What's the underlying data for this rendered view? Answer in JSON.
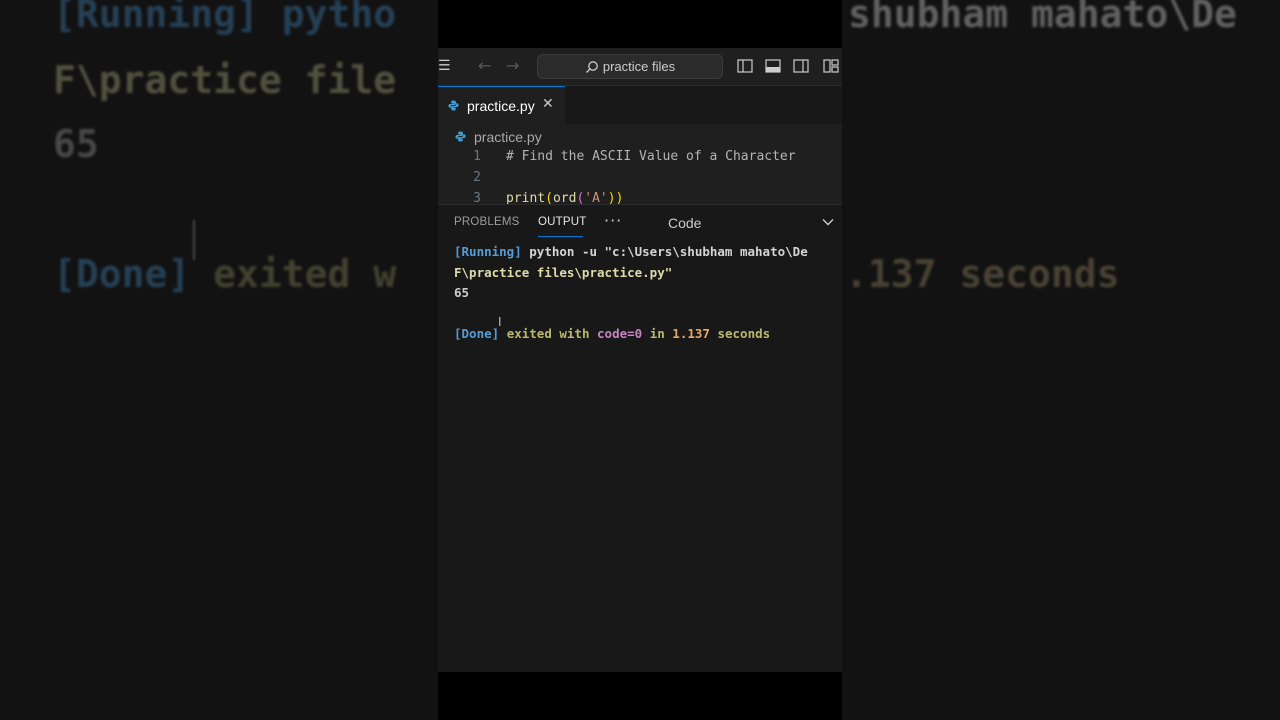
{
  "background": {
    "line1": "[Running] pytho",
    "line1_right": "shubham mahato\\De",
    "line2": "F\\practice file",
    "line3": "65",
    "line4_done": "[Done]",
    "line4_mid": "exited w",
    "line4_right": ".137 seconds"
  },
  "titlebar": {
    "search_placeholder": "practice files",
    "icons": [
      "menu-icon",
      "back-arrow-icon",
      "forward-arrow-icon",
      "search-icon",
      "toggle-primary-sidebar-icon",
      "toggle-panel-icon",
      "toggle-secondary-sidebar-icon",
      "customize-layout-icon"
    ]
  },
  "tab": {
    "label": "practice.py",
    "close": "✕"
  },
  "editor": {
    "breadcrumb": "practice.py",
    "lines": [
      {
        "num": "1",
        "text": "# Find the ASCII Value of a Character"
      },
      {
        "num": "2",
        "text": ""
      },
      {
        "num": "3",
        "fn1": "print",
        "p1": "(",
        "fn2": "ord",
        "p2": "(",
        "str": "'A'",
        "p3": "))"
      }
    ]
  },
  "panel": {
    "tab_problems": "PROBLEMS",
    "tab_output": "OUTPUT",
    "more": "···",
    "channel": "Code",
    "output": {
      "running_tag": "[Running]",
      "running_cmd": "python -u \"c:\\Users\\shubham mahato\\De",
      "running_cmd2": "F\\practice files\\practice.py\"",
      "result": "65",
      "done_tag": "[Done]",
      "done_w1": "exited with",
      "done_code": "code=0",
      "done_in": "in",
      "done_time": "1.137",
      "done_seconds": "seconds"
    }
  },
  "colors": {
    "accent": "#0078d4",
    "editor_bg": "#1f1f1f",
    "panel_bg": "#181818"
  }
}
